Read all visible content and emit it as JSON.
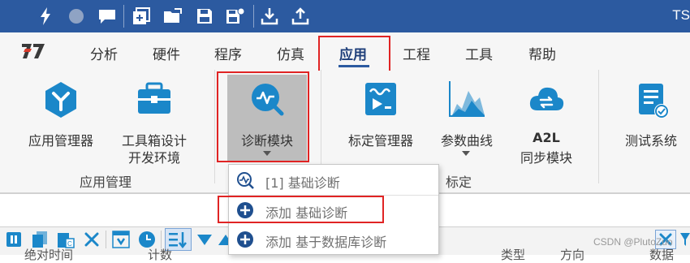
{
  "titlebar": {
    "title_fragment": "TS"
  },
  "menu": {
    "tabs": [
      "分析",
      "硬件",
      "程序",
      "仿真",
      "应用",
      "工程",
      "工具",
      "帮助"
    ],
    "active_tab": "应用"
  },
  "ribbon": {
    "app_manager": "应用管理器",
    "toolbox_line1": "工具箱设计",
    "toolbox_line2": "开发环境",
    "diag_module": "诊断模块",
    "calib_manager": "标定管理器",
    "param_curve": "参数曲线",
    "a2l_line1": "A2L",
    "a2l_line2": "同步模块",
    "test_system": "测试系统",
    "group_app_mgmt": "应用管理",
    "group_calib": "标定"
  },
  "dropdown": {
    "items": [
      "[1] 基础诊断",
      "添加 基础诊断",
      "添加 基于数据库诊断"
    ]
  },
  "bottom": {
    "cut_labels": [
      "绝对时间",
      "计数",
      "类型",
      "方向",
      "数据"
    ]
  },
  "watermark": "CSDN @PlutoZuo",
  "colors": {
    "title_bar": "#2c5aa0",
    "accent_red": "#e02424",
    "icon_blue": "#1b87c9"
  }
}
